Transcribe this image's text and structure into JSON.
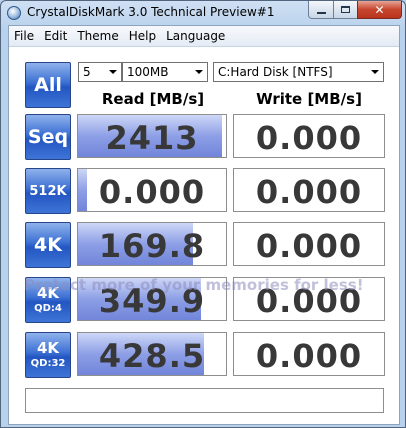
{
  "window": {
    "title": "CrystalDiskMark 3.0 Technical Preview#1"
  },
  "menu": [
    "File",
    "Edit",
    "Theme",
    "Help",
    "Language"
  ],
  "controls": {
    "all_label": "All",
    "count": "5",
    "size": "100MB",
    "drive": "C:Hard Disk [NTFS]"
  },
  "headers": {
    "read": "Read [MB/s]",
    "write": "Write [MB/s]"
  },
  "rows": [
    {
      "label": "Seq",
      "sub": "",
      "read": "2413",
      "write": "0.000",
      "read_fill": 0.97,
      "write_fill": 0
    },
    {
      "label": "512K",
      "sub": "",
      "read": "0.000",
      "write": "0.000",
      "read_fill": 0.06,
      "write_fill": 0
    },
    {
      "label": "4K",
      "sub": "",
      "read": "169.8",
      "write": "0.000",
      "read_fill": 0.78,
      "write_fill": 0
    },
    {
      "label": "4K",
      "sub": "QD:4",
      "read": "349.9",
      "write": "0.000",
      "read_fill": 0.83,
      "write_fill": 0
    },
    {
      "label": "4K",
      "sub": "QD:32",
      "read": "428.5",
      "write": "0.000",
      "read_fill": 0.85,
      "write_fill": 0
    }
  ],
  "comment": "",
  "watermark": "Protect more of your memories for less!",
  "colors": {
    "tile": "#3c6fd3",
    "bar": "#8d9fe6",
    "close": "#c7452d"
  }
}
